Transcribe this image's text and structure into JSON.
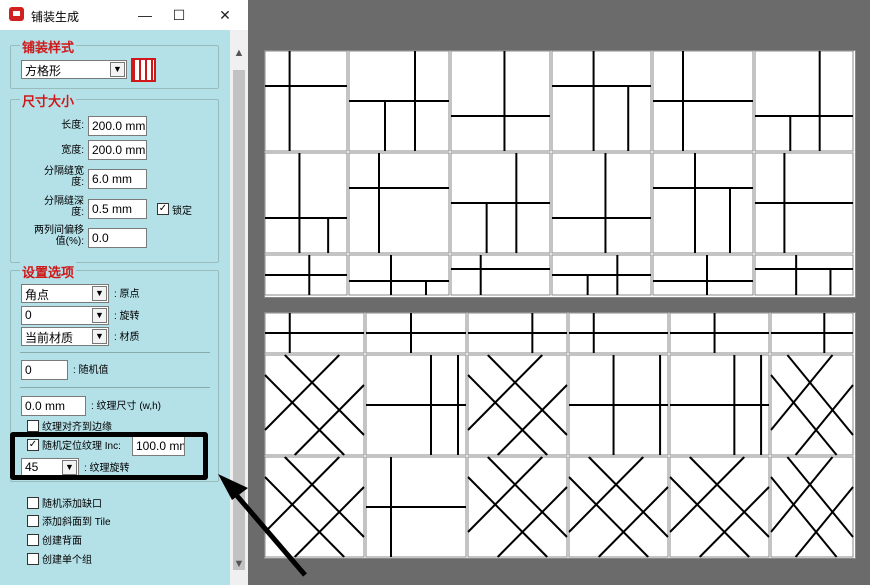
{
  "window": {
    "title": "铺装生成",
    "minimize": "—",
    "maximize": "☐",
    "close": "✕"
  },
  "style_group": {
    "title": "铺装样式",
    "pattern_value": "方格形"
  },
  "size_group": {
    "title": "尺寸大小",
    "length_label": "长度:",
    "length_value": "200.0 mm",
    "width_label": "宽度:",
    "width_value": "200.0 mm",
    "gap_width_label": "分隔缝宽度:",
    "gap_width_value": "6.0 mm",
    "gap_depth_label": "分隔缝深度:",
    "gap_depth_value": "0.5 mm",
    "lock_label": "锁定",
    "offset_label": "两列间偏移值(%):",
    "offset_value": "0.0"
  },
  "options_group": {
    "title": "设置选项",
    "origin_value": "角点",
    "origin_label": ": 原点",
    "rotation_value": "0",
    "rotation_label": ": 旋转",
    "material_value": "当前材质",
    "material_label": ": 材质",
    "random_value": "0",
    "random_label": ": 随机值",
    "texture_size_value": "0.0 mm",
    "texture_size_label": ": 纹理尺寸 (w,h)",
    "align_texture_label": "纹理对齐到边缘",
    "random_texture_label": "随机定位纹理 Inc:",
    "random_texture_value": "100.0 mm",
    "texture_rot_value": "45",
    "texture_rot_label": ": 纹理旋转",
    "random_notch_label": "随机添加缺口",
    "bevel_label": "添加斜面到 Tile",
    "back_face_label": "创建背面",
    "single_group_label": "创建单个组"
  },
  "colors": {
    "accent": "#d01818",
    "panel_bg": "#b4e0e8",
    "canvas_bg": "#6b6b6b"
  }
}
